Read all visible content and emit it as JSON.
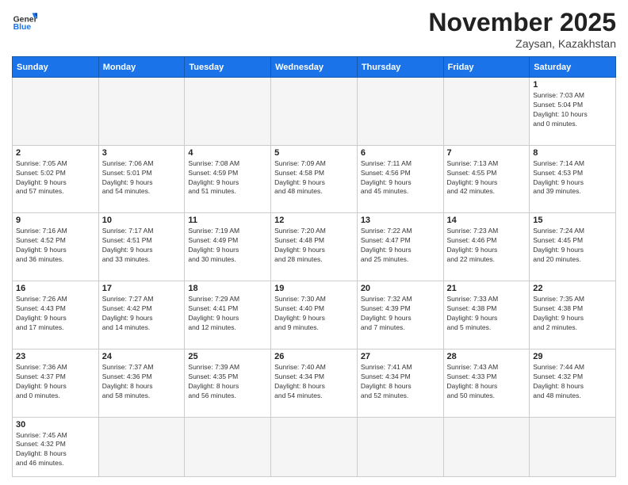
{
  "header": {
    "logo_general": "General",
    "logo_blue": "Blue",
    "month_title": "November 2025",
    "location": "Zaysan, Kazakhstan"
  },
  "weekdays": [
    "Sunday",
    "Monday",
    "Tuesday",
    "Wednesday",
    "Thursday",
    "Friday",
    "Saturday"
  ],
  "days": {
    "d1": {
      "num": "1",
      "sunrise": "7:03 AM",
      "sunset": "5:04 PM",
      "daylight_h": "10",
      "daylight_m": "0"
    },
    "d2": {
      "num": "2",
      "sunrise": "7:05 AM",
      "sunset": "5:02 PM",
      "daylight_h": "9",
      "daylight_m": "57"
    },
    "d3": {
      "num": "3",
      "sunrise": "7:06 AM",
      "sunset": "5:01 PM",
      "daylight_h": "9",
      "daylight_m": "54"
    },
    "d4": {
      "num": "4",
      "sunrise": "7:08 AM",
      "sunset": "4:59 PM",
      "daylight_h": "9",
      "daylight_m": "51"
    },
    "d5": {
      "num": "5",
      "sunrise": "7:09 AM",
      "sunset": "4:58 PM",
      "daylight_h": "9",
      "daylight_m": "48"
    },
    "d6": {
      "num": "6",
      "sunrise": "7:11 AM",
      "sunset": "4:56 PM",
      "daylight_h": "9",
      "daylight_m": "45"
    },
    "d7": {
      "num": "7",
      "sunrise": "7:13 AM",
      "sunset": "4:55 PM",
      "daylight_h": "9",
      "daylight_m": "42"
    },
    "d8": {
      "num": "8",
      "sunrise": "7:14 AM",
      "sunset": "4:53 PM",
      "daylight_h": "9",
      "daylight_m": "39"
    },
    "d9": {
      "num": "9",
      "sunrise": "7:16 AM",
      "sunset": "4:52 PM",
      "daylight_h": "9",
      "daylight_m": "36"
    },
    "d10": {
      "num": "10",
      "sunrise": "7:17 AM",
      "sunset": "4:51 PM",
      "daylight_h": "9",
      "daylight_m": "33"
    },
    "d11": {
      "num": "11",
      "sunrise": "7:19 AM",
      "sunset": "4:49 PM",
      "daylight_h": "9",
      "daylight_m": "30"
    },
    "d12": {
      "num": "12",
      "sunrise": "7:20 AM",
      "sunset": "4:48 PM",
      "daylight_h": "9",
      "daylight_m": "28"
    },
    "d13": {
      "num": "13",
      "sunrise": "7:22 AM",
      "sunset": "4:47 PM",
      "daylight_h": "9",
      "daylight_m": "25"
    },
    "d14": {
      "num": "14",
      "sunrise": "7:23 AM",
      "sunset": "4:46 PM",
      "daylight_h": "9",
      "daylight_m": "22"
    },
    "d15": {
      "num": "15",
      "sunrise": "7:24 AM",
      "sunset": "4:45 PM",
      "daylight_h": "9",
      "daylight_m": "20"
    },
    "d16": {
      "num": "16",
      "sunrise": "7:26 AM",
      "sunset": "4:43 PM",
      "daylight_h": "9",
      "daylight_m": "17"
    },
    "d17": {
      "num": "17",
      "sunrise": "7:27 AM",
      "sunset": "4:42 PM",
      "daylight_h": "9",
      "daylight_m": "14"
    },
    "d18": {
      "num": "18",
      "sunrise": "7:29 AM",
      "sunset": "4:41 PM",
      "daylight_h": "9",
      "daylight_m": "12"
    },
    "d19": {
      "num": "19",
      "sunrise": "7:30 AM",
      "sunset": "4:40 PM",
      "daylight_h": "9",
      "daylight_m": "9"
    },
    "d20": {
      "num": "20",
      "sunrise": "7:32 AM",
      "sunset": "4:39 PM",
      "daylight_h": "9",
      "daylight_m": "7"
    },
    "d21": {
      "num": "21",
      "sunrise": "7:33 AM",
      "sunset": "4:38 PM",
      "daylight_h": "9",
      "daylight_m": "5"
    },
    "d22": {
      "num": "22",
      "sunrise": "7:35 AM",
      "sunset": "4:38 PM",
      "daylight_h": "9",
      "daylight_m": "2"
    },
    "d23": {
      "num": "23",
      "sunrise": "7:36 AM",
      "sunset": "4:37 PM",
      "daylight_h": "9",
      "daylight_m": "0"
    },
    "d24": {
      "num": "24",
      "sunrise": "7:37 AM",
      "sunset": "4:36 PM",
      "daylight_h": "8",
      "daylight_m": "58"
    },
    "d25": {
      "num": "25",
      "sunrise": "7:39 AM",
      "sunset": "4:35 PM",
      "daylight_h": "8",
      "daylight_m": "56"
    },
    "d26": {
      "num": "26",
      "sunrise": "7:40 AM",
      "sunset": "4:34 PM",
      "daylight_h": "8",
      "daylight_m": "54"
    },
    "d27": {
      "num": "27",
      "sunrise": "7:41 AM",
      "sunset": "4:34 PM",
      "daylight_h": "8",
      "daylight_m": "52"
    },
    "d28": {
      "num": "28",
      "sunrise": "7:43 AM",
      "sunset": "4:33 PM",
      "daylight_h": "8",
      "daylight_m": "50"
    },
    "d29": {
      "num": "29",
      "sunrise": "7:44 AM",
      "sunset": "4:32 PM",
      "daylight_h": "8",
      "daylight_m": "48"
    },
    "d30": {
      "num": "30",
      "sunrise": "7:45 AM",
      "sunset": "4:32 PM",
      "daylight_h": "8",
      "daylight_m": "46"
    }
  },
  "labels": {
    "sunrise": "Sunrise:",
    "sunset": "Sunset:",
    "daylight": "Daylight:",
    "hours": "hours",
    "and": "and",
    "minutes": "minutes."
  }
}
